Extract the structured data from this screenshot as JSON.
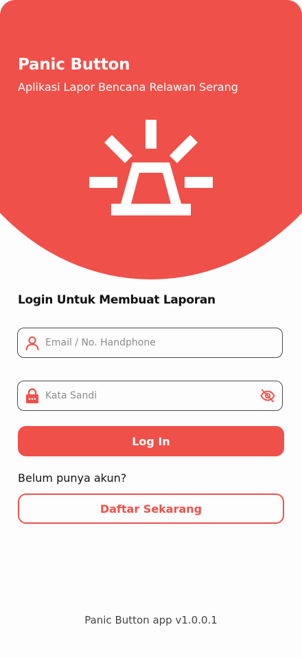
{
  "header": {
    "title": "Panic Button",
    "subtitle": "Aplikasi Lapor Bencana Relawan Serang",
    "logo_icon": "siren-icon"
  },
  "login": {
    "heading": "Login Untuk Membuat Laporan",
    "email": {
      "icon": "user-icon",
      "placeholder": "Email / No. Handphone",
      "value": ""
    },
    "password": {
      "icon": "lock-icon",
      "placeholder": "Kata Sandi",
      "value": "",
      "toggle_icon": "eye-off-icon"
    },
    "login_button": "Log In",
    "no_account_text": "Belum punya akun?",
    "register_button": "Daftar Sekarang"
  },
  "footer": {
    "version": "Panic Button app v1.0.0.1"
  },
  "colors": {
    "accent": "#ef5049",
    "background": "#fdfdfd",
    "text": "#111111"
  }
}
